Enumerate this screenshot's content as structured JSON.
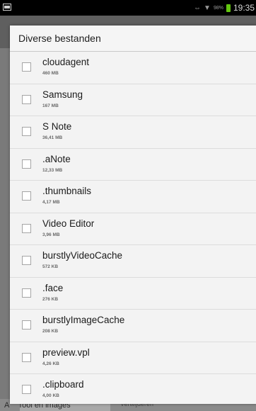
{
  "statusbar": {
    "clock": "19:35",
    "battery_label": "98%",
    "battery_color": "#63c60f",
    "icons": [
      "notification-icon",
      "sync-icon",
      "signal-icon",
      "battery-icon"
    ]
  },
  "background": {
    "category_label": "A",
    "tab_label": "Tool en images",
    "delete_label": "Verwijderen"
  },
  "dialog": {
    "title": "Diverse bestanden",
    "items": [
      {
        "name": "cloudagent",
        "size": "460 MB"
      },
      {
        "name": "Samsung",
        "size": "167 MB"
      },
      {
        "name": "S Note",
        "size": "36,41 MB"
      },
      {
        "name": ".aNote",
        "size": "12,33 MB"
      },
      {
        "name": ".thumbnails",
        "size": "4,17 MB"
      },
      {
        "name": "Video Editor",
        "size": "3,96 MB"
      },
      {
        "name": "burstlyVideoCache",
        "size": "572 KB"
      },
      {
        "name": ".face",
        "size": "276 KB"
      },
      {
        "name": "burstlyImageCache",
        "size": "208 KB"
      },
      {
        "name": "preview.vpl",
        "size": "4,26 KB"
      },
      {
        "name": ".clipboard",
        "size": "4,00 KB"
      }
    ]
  }
}
